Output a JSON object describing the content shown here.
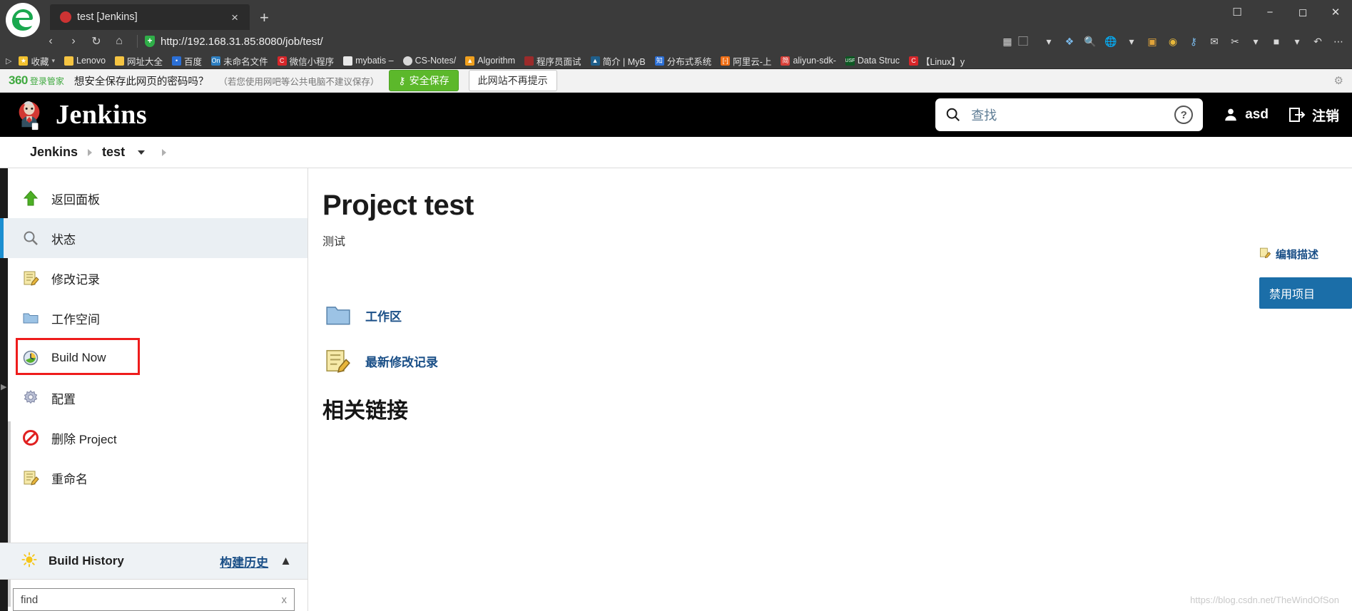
{
  "browser": {
    "tab": {
      "title": "test [Jenkins]",
      "close_label": "×",
      "favicon": "jenkins-favicon"
    },
    "new_tab_label": "+",
    "window_controls": [
      "❐",
      "─",
      "☐",
      "✕"
    ],
    "nav": {
      "back": "‹",
      "forward": "›",
      "reload": "↻",
      "home": "⌂",
      "url": "http://192.168.31.85:8080/job/test/",
      "security_icon": "shield-icon"
    },
    "nav_right": [
      "grid-icon",
      "reader-icon",
      "chevron-down-icon",
      "collections-icon",
      "search-icon",
      "globe-icon",
      "chevron-down-icon",
      "note-icon",
      "smiley-icon",
      "key-icon",
      "chat-icon",
      "scissors-icon",
      "chevron-down-icon",
      "puzzle-icon",
      "chevron-down-icon",
      "undo-icon",
      "more-icon"
    ],
    "bookmarks": [
      {
        "label": "收藏",
        "icon": "star-icon",
        "color": "#f2c12e",
        "caret": true
      },
      {
        "label": "Lenovo",
        "icon": "folder-icon",
        "color": "#f5c442"
      },
      {
        "label": "网址大全",
        "icon": "folder-icon",
        "color": "#f5c442"
      },
      {
        "label": "百度",
        "icon": "baidu-icon",
        "color": "#2b6fd6"
      },
      {
        "label": "未命名文件",
        "icon": "onenote-icon",
        "color": "#2d7fc1"
      },
      {
        "label": "微信小程序",
        "icon": "csdn-icon",
        "color": "#d7262a"
      },
      {
        "label": "mybatis –",
        "icon": "doc-icon",
        "color": "#e8e8e8"
      },
      {
        "label": "CS-Notes/",
        "icon": "github-icon",
        "color": "#d8d8d8"
      },
      {
        "label": "Algorithm",
        "icon": "leetcode-icon",
        "color": "#f0a01e"
      },
      {
        "label": "程序员面试",
        "icon": "site-icon",
        "color": "#9b2b2b"
      },
      {
        "label": "简介 | MyB",
        "icon": "mybatis-icon",
        "color": "#1f5f8b"
      },
      {
        "label": "分布式系统",
        "icon": "zhihu-icon",
        "color": "#2b6fd6"
      },
      {
        "label": "阿里云-上",
        "icon": "aliyun-icon",
        "color": "#f06f16"
      },
      {
        "label": "aliyun-sdk-",
        "icon": "jianshu-icon",
        "color": "#d8413a"
      },
      {
        "label": "Data Struc",
        "icon": "usf-icon",
        "color": "#0d5723"
      },
      {
        "label": "【Linux】y",
        "icon": "csdn-icon",
        "color": "#d7262a"
      }
    ]
  },
  "password_bar": {
    "brand_number": "360",
    "brand_label": "登录管家",
    "question": "想安全保存此网页的密码吗？",
    "hint": "（若您使用网吧等公共电脑不建议保存）",
    "save_label": "安全保存",
    "never_label": "此网站不再提示",
    "gear_icon": "gear-icon",
    "save_color": "#5cb82b"
  },
  "jenkins_header": {
    "title": "Jenkins",
    "search_placeholder": "查找",
    "search_icon": "search-icon",
    "help_icon": "help-icon",
    "user_name": "asd",
    "user_icon": "person-icon",
    "logout_label": "注销",
    "logout_icon": "logout-icon"
  },
  "breadcrumb": {
    "items": [
      {
        "label": "Jenkins",
        "caret": false
      },
      {
        "label": "test",
        "caret": true
      }
    ]
  },
  "sidebar": {
    "items": [
      {
        "label": "返回面板",
        "icon": "up-arrow-icon",
        "active": false,
        "highlighted": false
      },
      {
        "label": "状态",
        "icon": "magnifier-icon",
        "active": true,
        "highlighted": false
      },
      {
        "label": "修改记录",
        "icon": "notepad-icon",
        "active": false,
        "highlighted": false
      },
      {
        "label": "工作空间",
        "icon": "folder-icon",
        "active": false,
        "highlighted": false
      },
      {
        "label": "Build Now",
        "icon": "clock-build-icon",
        "active": false,
        "highlighted": true
      },
      {
        "label": "配置",
        "icon": "gear-icon",
        "active": false,
        "highlighted": false
      },
      {
        "label": "删除 Project",
        "icon": "delete-icon",
        "active": false,
        "highlighted": false
      },
      {
        "label": "重命名",
        "icon": "notepad-icon",
        "active": false,
        "highlighted": false
      }
    ],
    "highlight_color": "#ee1c1c",
    "build_history": {
      "title": "Build History",
      "icon": "sun-icon",
      "link_label": "构建历史",
      "collapse_icon": "chevron-up-icon",
      "find_value": "find",
      "find_clear": "x"
    }
  },
  "main": {
    "project_title": "Project test",
    "description": "测试",
    "links": [
      {
        "label": "工作区",
        "icon": "folder-icon"
      },
      {
        "label": "最新修改记录",
        "icon": "notepad-icon"
      }
    ],
    "related_links_heading": "相关链接",
    "edit_description": "编辑描述",
    "edit_description_icon": "edit-icon",
    "disable_project": "禁用项目",
    "disable_color": "#1b6ea8"
  },
  "watermark": "https://blog.csdn.net/TheWindOfSon"
}
